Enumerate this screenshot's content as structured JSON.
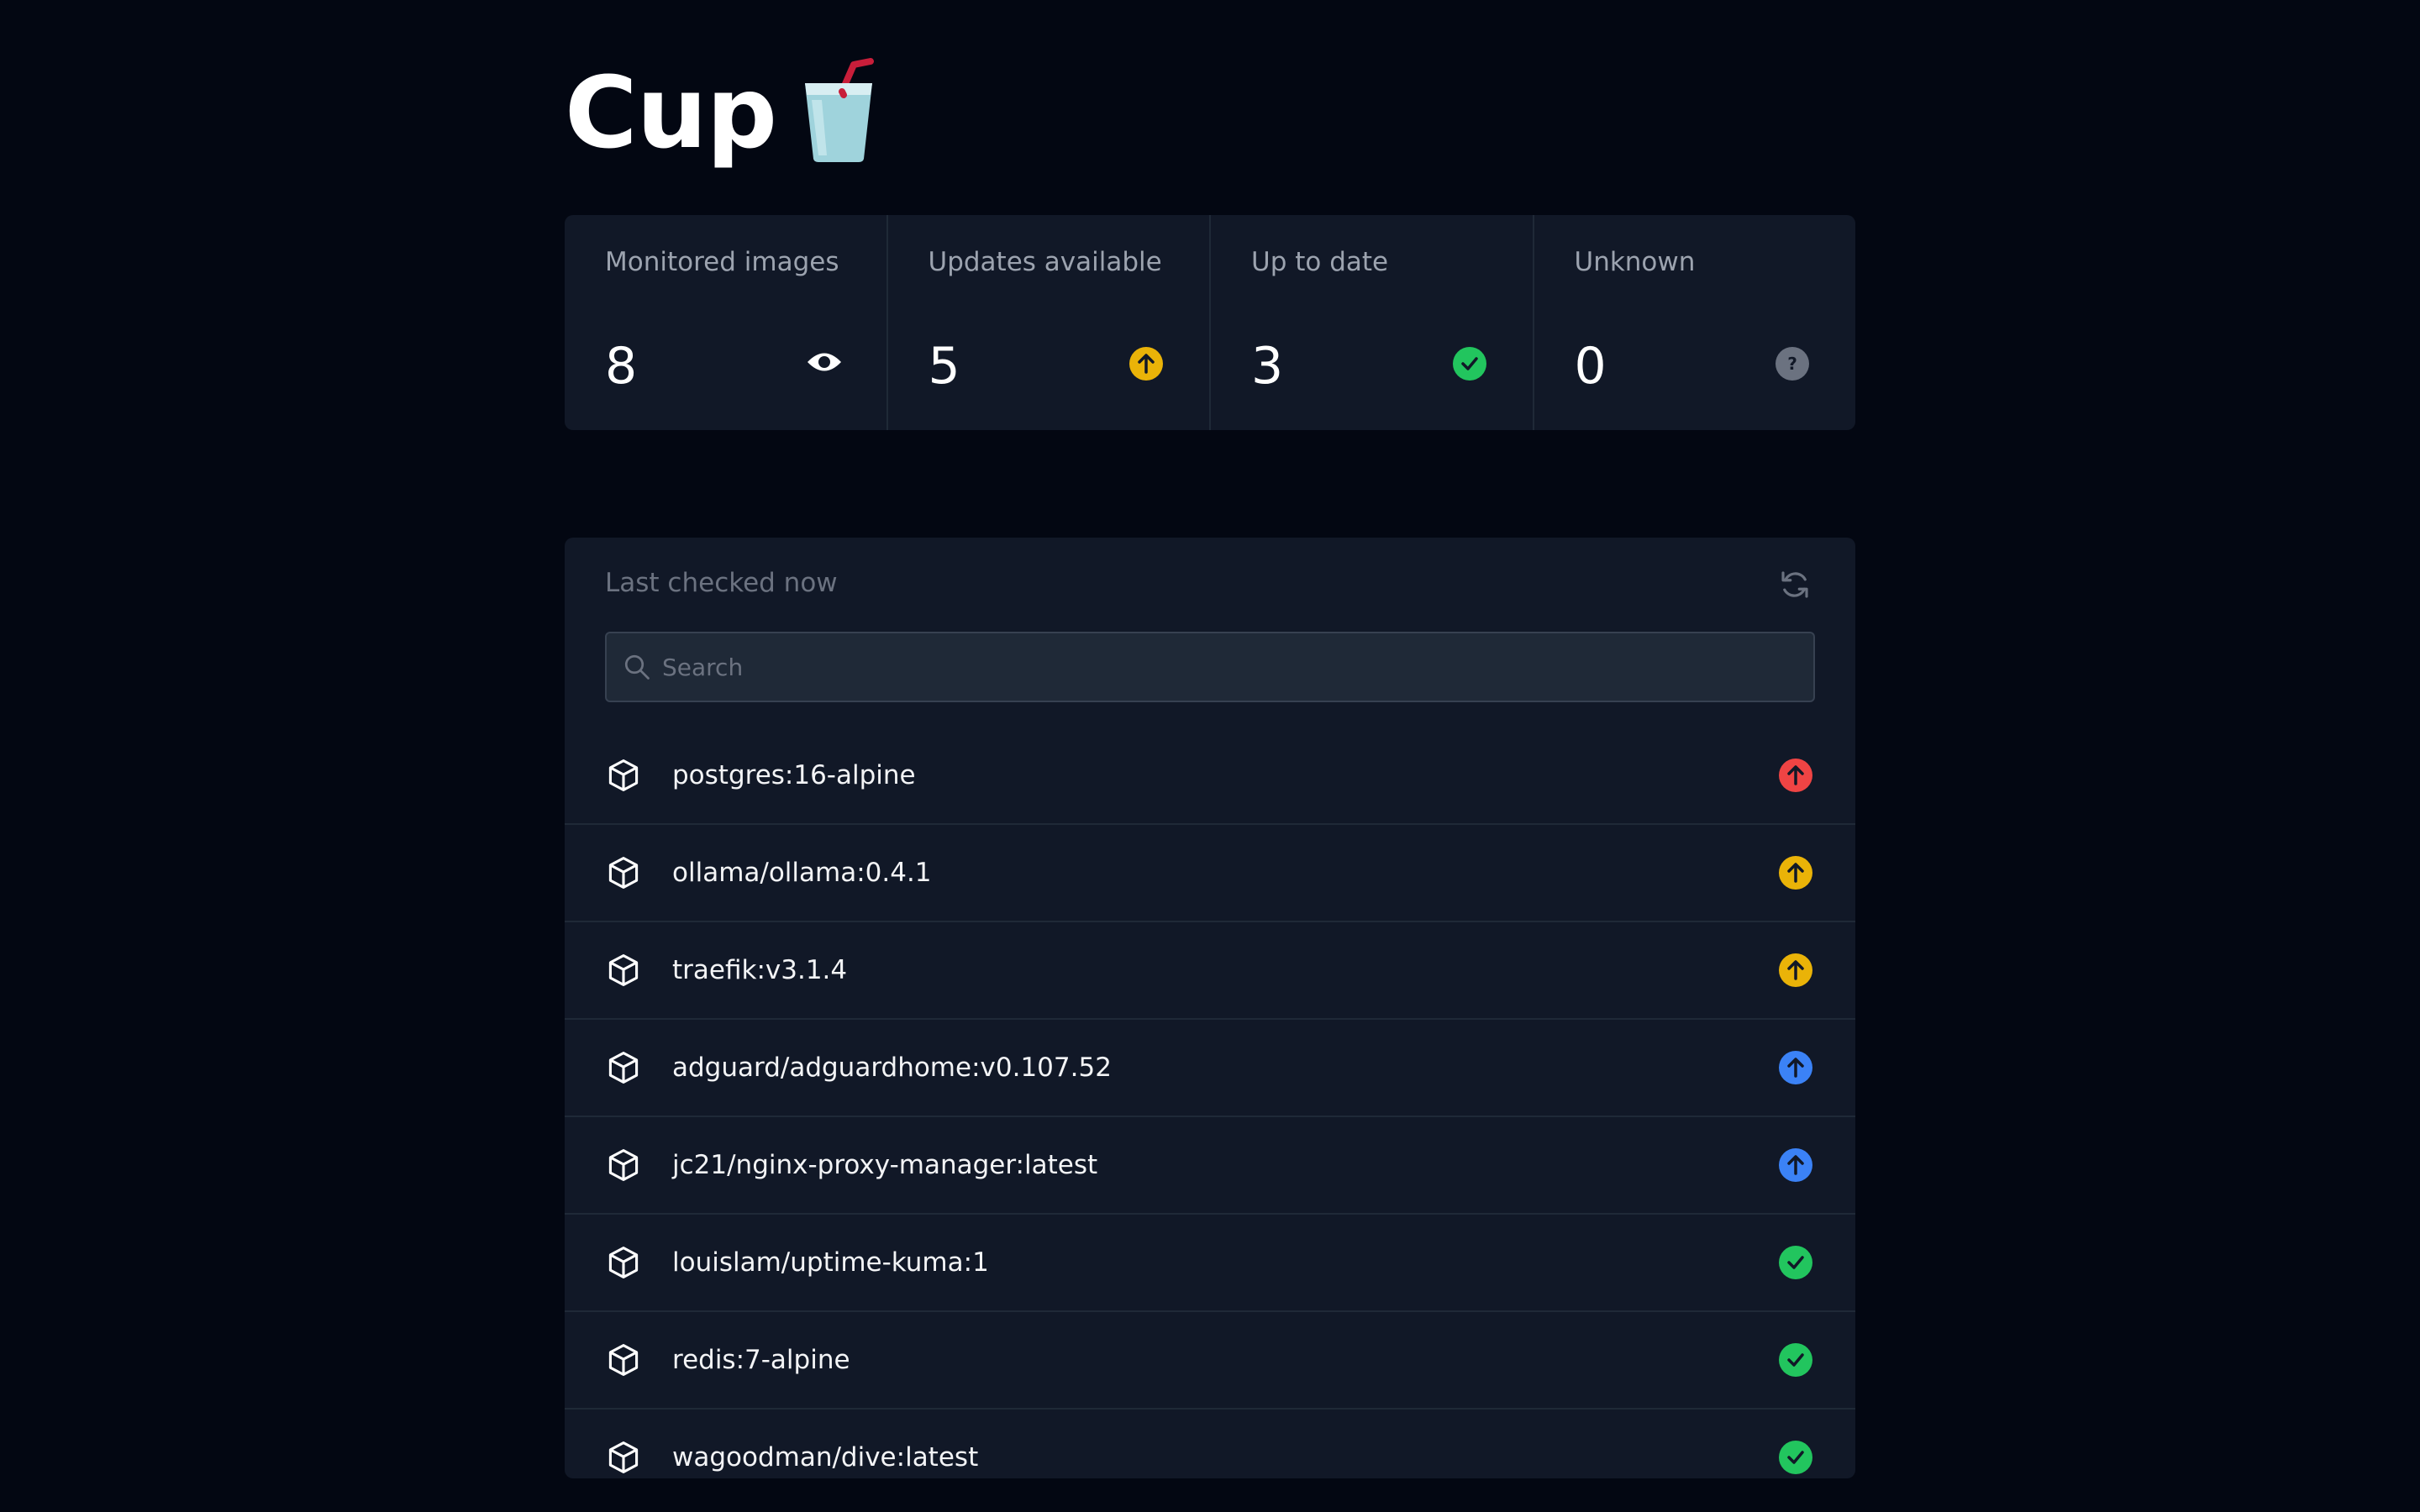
{
  "app": {
    "title": "Cup",
    "logo_icon": "cup-with-straw-icon"
  },
  "stats": [
    {
      "label": "Monitored images",
      "value": "8",
      "icon": "eye-icon",
      "color": "#ffffff"
    },
    {
      "label": "Updates available",
      "value": "5",
      "icon": "arrow-up-circle-icon",
      "color": "#eab308"
    },
    {
      "label": "Up to date",
      "value": "3",
      "icon": "check-circle-icon",
      "color": "#22c55e"
    },
    {
      "label": "Unknown",
      "value": "0",
      "icon": "question-circle-icon",
      "color": "#6b7280"
    }
  ],
  "list": {
    "last_checked": "Last checked now",
    "refresh_icon": "refresh-icon",
    "search_placeholder": "Search",
    "images": [
      {
        "name": "postgres:16-alpine",
        "status": "update-major",
        "icon": "arrow-up-circle-icon",
        "color": "#ef4444"
      },
      {
        "name": "ollama/ollama:0.4.1",
        "status": "update-minor",
        "icon": "arrow-up-circle-icon",
        "color": "#eab308"
      },
      {
        "name": "traefik:v3.1.4",
        "status": "update-minor",
        "icon": "arrow-up-circle-icon",
        "color": "#eab308"
      },
      {
        "name": "adguard/adguardhome:v0.107.52",
        "status": "update-digest",
        "icon": "arrow-up-circle-icon",
        "color": "#3b82f6"
      },
      {
        "name": "jc21/nginx-proxy-manager:latest",
        "status": "update-digest",
        "icon": "arrow-up-circle-icon",
        "color": "#3b82f6"
      },
      {
        "name": "louislam/uptime-kuma:1",
        "status": "up-to-date",
        "icon": "check-circle-icon",
        "color": "#22c55e"
      },
      {
        "name": "redis:7-alpine",
        "status": "up-to-date",
        "icon": "check-circle-icon",
        "color": "#22c55e"
      },
      {
        "name": "wagoodman/dive:latest",
        "status": "up-to-date",
        "icon": "check-circle-icon",
        "color": "#22c55e"
      }
    ]
  },
  "colors": {
    "background": "#030712",
    "card": "#111827",
    "divider": "#1f2937",
    "update_major": "#ef4444",
    "update_minor": "#eab308",
    "update_digest": "#3b82f6",
    "up_to_date": "#22c55e",
    "unknown": "#6b7280"
  }
}
